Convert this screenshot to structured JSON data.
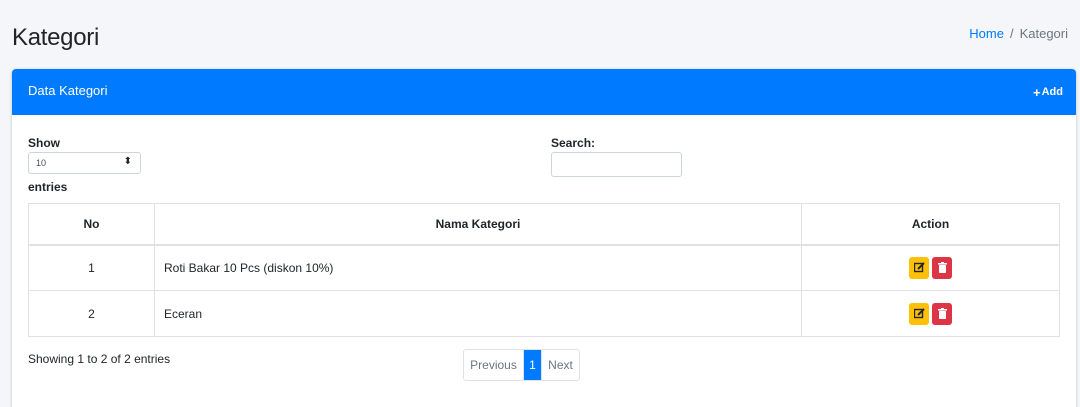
{
  "page": {
    "title": "Kategori"
  },
  "breadcrumb": {
    "home": "Home",
    "current": "Kategori",
    "separator": "/"
  },
  "card": {
    "title": "Data Kategori",
    "add_label": "Add",
    "add_icon": "plus-icon"
  },
  "length": {
    "label": "Show",
    "value": "10",
    "suffix": "entries"
  },
  "search": {
    "label": "Search:",
    "value": ""
  },
  "table": {
    "headers": [
      "No",
      "Nama Kategori",
      "Action"
    ],
    "rows": [
      {
        "no": "1",
        "name": "Roti Bakar 10 Pcs (diskon 10%)"
      },
      {
        "no": "2",
        "name": "Eceran"
      }
    ]
  },
  "footer": {
    "info": "Showing 1 to 2 of 2 entries",
    "previous": "Previous",
    "current_page": "1",
    "next": "Next"
  },
  "colors": {
    "primary": "#007bff",
    "edit": "#ffc107",
    "delete": "#dc3545"
  }
}
